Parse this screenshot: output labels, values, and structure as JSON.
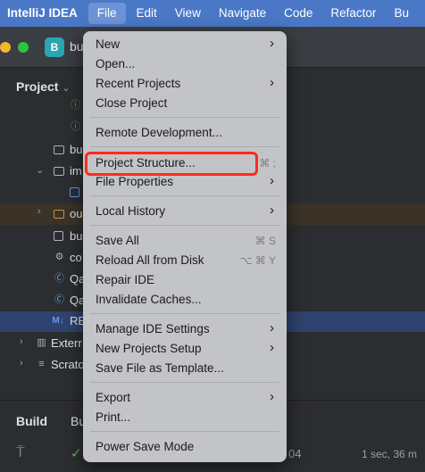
{
  "menubar": {
    "app_name": "IntelliJ IDEA",
    "items": [
      "File",
      "Edit",
      "View",
      "Navigate",
      "Code",
      "Refactor",
      "Bu"
    ]
  },
  "titlebar": {
    "project_badge": "B",
    "project_name": "bu"
  },
  "project_panel": {
    "header": "Project",
    "rows": [
      "bu",
      "im",
      "ou",
      "bu",
      "co",
      "Qa",
      "Qa",
      "RE",
      "Exterr",
      "Scrato"
    ]
  },
  "bottom_panel": {
    "tab_build": "Build",
    "tab_second": "Bu",
    "status_fragment": "04",
    "time": "1 sec, 36 m"
  },
  "file_menu": {
    "items": [
      {
        "label": "New",
        "submenu": true
      },
      {
        "label": "Open..."
      },
      {
        "label": "Recent Projects",
        "submenu": true
      },
      {
        "label": "Close Project"
      },
      {
        "label": "Remote Development..."
      },
      {
        "label": "Project Structure...",
        "shortcut": "⌘ ;"
      },
      {
        "label": "File Properties",
        "submenu": true
      },
      {
        "label": "Local History",
        "submenu": true
      },
      {
        "label": "Save All",
        "shortcut": "⌘ S"
      },
      {
        "label": "Reload All from Disk",
        "shortcut": "⌥ ⌘ Y"
      },
      {
        "label": "Repair IDE"
      },
      {
        "label": "Invalidate Caches..."
      },
      {
        "label": "Manage IDE Settings",
        "submenu": true
      },
      {
        "label": "New Projects Setup",
        "submenu": true
      },
      {
        "label": "Save File as Template..."
      },
      {
        "label": "Export",
        "submenu": true
      },
      {
        "label": "Print..."
      },
      {
        "label": "Power Save Mode"
      }
    ]
  },
  "colors": {
    "menubar": "#4a78c6",
    "menu_background": "#c3c4c7",
    "highlight": "#ff2a1a",
    "ide_background": "#2b2d30"
  }
}
